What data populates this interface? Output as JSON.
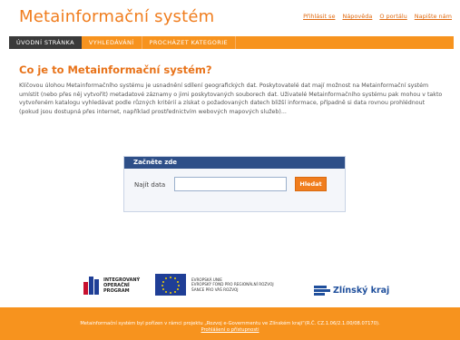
{
  "header": {
    "title": "Metainformační systém",
    "links": [
      "Přihlásit se",
      "Nápověda",
      "O portálu",
      "Napište nám"
    ]
  },
  "nav": {
    "tabs": [
      {
        "label": "ÚVODNÍ STRÁNKA",
        "active": true
      },
      {
        "label": "VYHLEDÁVÁNÍ",
        "active": false
      },
      {
        "label": "PROCHÁZET KATEGORIE",
        "active": false
      }
    ]
  },
  "main": {
    "heading": "Co je to Metainformační systém?",
    "intro": "Klíčovou úlohou Metainformačního systému je usnadnění sdílení geografických dat. Poskytovatelé dat mají možnost na Metainformační systém umístit (nebo přes něj vytvořit) metadatové záznamy o jimi poskytovaných souborech dat. Uživatelé Metainformačního systému pak mohou v takto vytvořeném katalogu vyhledávat podle různých kritérií a získat o požadovaných datech bližší informace, případně si data rovnou prohlédnout (pokud jsou dostupná přes internet, například prostřednictvím webových mapových služeb)..."
  },
  "search": {
    "title": "Začněte zde",
    "label": "Najít data",
    "value": "",
    "button": "Hledat"
  },
  "logos": {
    "iop_lines": [
      "INTEGROVANÝ",
      "OPERAČNÍ",
      "PROGRAM"
    ],
    "eu_lines": [
      "EVROPSKÁ UNIE",
      "EVROPSKÝ FOND PRO REGIONÁLNÍ ROZVOJ",
      "ŠANCE PRO VÁŠ ROZVOJ"
    ],
    "region": "Zlínský kraj"
  },
  "footer": {
    "text": "Metainformační systém byl pořízen v rámci projektu „Rozvoj e-Governmentu ve Zlínském kraji“(R.Č. CZ.1.06/2.1.00/08.07170).",
    "link": "Prohlášení o přístupnosti"
  },
  "colors": {
    "accent": "#f7931e",
    "title": "#f07d1e",
    "active_tab": "#3a3a3a",
    "search_header": "#2e4f88"
  }
}
